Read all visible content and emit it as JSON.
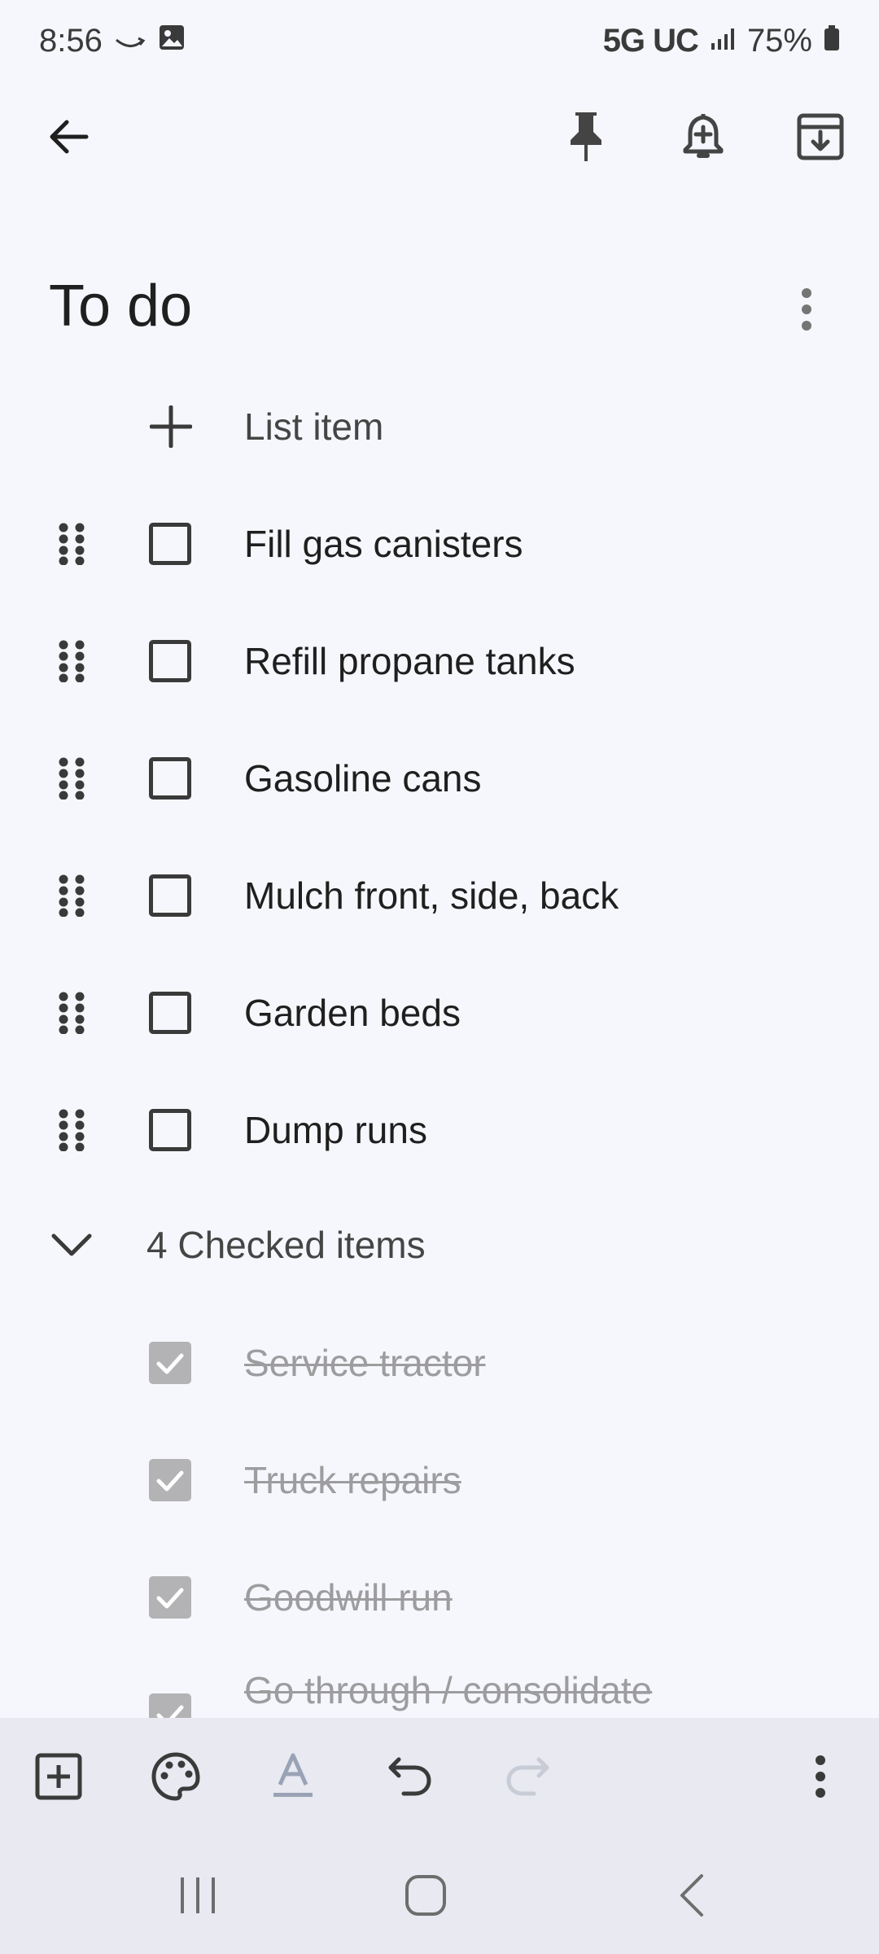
{
  "status": {
    "time": "8:56",
    "network": "5G UC",
    "battery": "75%"
  },
  "icons": {
    "back": "arrow-left-icon",
    "pin": "pin-icon",
    "reminder": "bell-plus-icon",
    "archive": "archive-icon",
    "more": "more-vert-icon"
  },
  "note": {
    "title": "To do",
    "add_item_placeholder": "List item",
    "unchecked_items": [
      "Fill gas canisters",
      "Refill propane tanks",
      "Gasoline cans",
      "Mulch front, side, back",
      "Garden beds",
      "Dump runs"
    ],
    "checked_header": "4 Checked items",
    "checked_items": [
      "Service tractor",
      "Truck repairs",
      "Goodwill run",
      "Go through / consolidate"
    ]
  },
  "toolbar": {
    "add": "add-box-icon",
    "palette": "palette-icon",
    "text_format": "text-format-icon",
    "undo": "undo-icon",
    "redo": "redo-icon",
    "more": "more-vert-icon"
  },
  "colors": {
    "background": "#f6f7fc",
    "toolbar": "#e8e9f1",
    "checked_box": "#b3b3b5",
    "struck_text": "#9d9d9f"
  }
}
